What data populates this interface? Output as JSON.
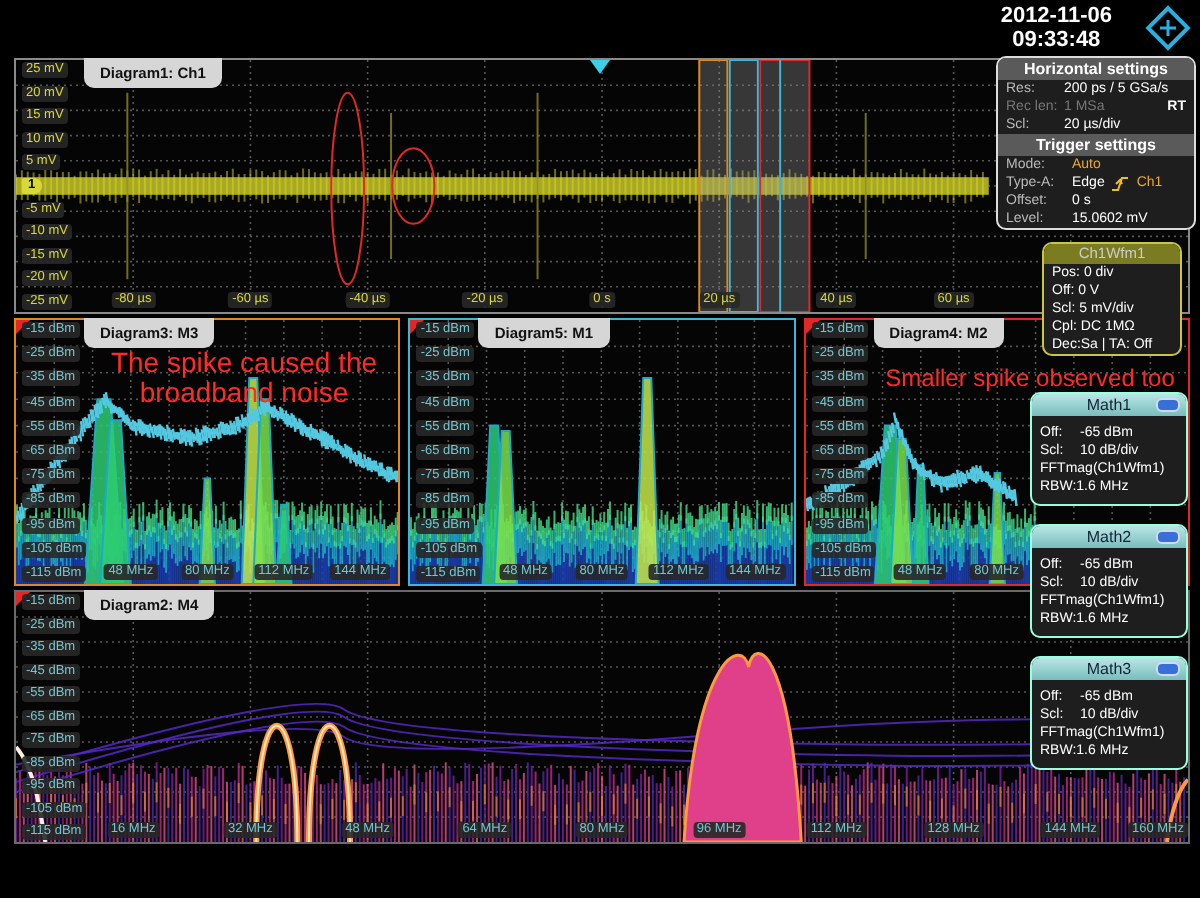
{
  "header": {
    "date": "2012-11-06",
    "time": "09:33:48"
  },
  "diagram_rows": [
    {
      "diagrams": [
        {
          "title": "Diagram1: Ch1",
          "kind": "waveform",
          "color": "#8a8a8a",
          "channel_marker": "1",
          "y_labels": [
            "25 mV",
            "20 mV",
            "15 mV",
            "10 mV",
            "5 mV",
            "-5 mV",
            "-10 mV",
            "-15 mV",
            "-20 mV",
            "-25 mV"
          ],
          "x_labels": [
            "-80 µs",
            "-60 µs",
            "-40 µs",
            "-20 µs",
            "0 s",
            "20 µs",
            "40 µs",
            "60 µs"
          ]
        }
      ]
    },
    {
      "diagrams": [
        {
          "title": "Diagram3: M3",
          "kind": "spectrum",
          "color": "#e0871e",
          "annotation": "The spike caused the broadband noise",
          "y_labels": [
            "-15 dBm",
            "-25 dBm",
            "-35 dBm",
            "-45 dBm",
            "-55 dBm",
            "-65 dBm",
            "-75 dBm",
            "-85 dBm",
            "-95 dBm",
            "-105 dBm",
            "-115 dBm"
          ],
          "x_labels": [
            "48 MHz",
            "80 MHz",
            "112 MHz",
            "144 MHz"
          ]
        },
        {
          "title": "Diagram5: M1",
          "kind": "spectrum",
          "color": "#3fb5d8",
          "y_labels": [
            "-15 dBm",
            "-25 dBm",
            "-35 dBm",
            "-45 dBm",
            "-55 dBm",
            "-65 dBm",
            "-75 dBm",
            "-85 dBm",
            "-95 dBm",
            "-105 dBm",
            "-115 dBm"
          ],
          "x_labels": [
            "48 MHz",
            "80 MHz",
            "112 MHz",
            "144 MHz"
          ]
        },
        {
          "title": "Diagram4: M2",
          "kind": "spectrum",
          "color": "#e02828",
          "annotation": "Smaller spike observed too",
          "y_labels": [
            "-15 dBm",
            "-25 dBm",
            "-35 dBm",
            "-45 dBm",
            "-55 dBm",
            "-65 dBm",
            "-75 dBm",
            "-85 dBm",
            "-95 dBm",
            "-105 dBm",
            "-115 dBm"
          ],
          "x_labels": [
            "48 MHz",
            "80 MHz"
          ]
        }
      ]
    },
    {
      "diagrams": [
        {
          "title": "Diagram2: M4",
          "kind": "persistence",
          "color": "#6a6a6a",
          "y_labels": [
            "-15 dBm",
            "-25 dBm",
            "-35 dBm",
            "-45 dBm",
            "-55 dBm",
            "-65 dBm",
            "-75 dBm",
            "-85 dBm",
            "-95 dBm",
            "-105 dBm",
            "-115 dBm"
          ],
          "x_labels": [
            "16 MHz",
            "32 MHz",
            "48 MHz",
            "64 MHz",
            "80 MHz",
            "96 MHz",
            "112 MHz",
            "128 MHz",
            "144 MHz",
            "160 MHz"
          ]
        }
      ]
    }
  ],
  "horizontal_settings": {
    "title": "Horizontal settings",
    "acquisition_mode": "RT",
    "rows": [
      {
        "label": "Res:",
        "value": "200 ps / 5 GSa/s",
        "disabled": false
      },
      {
        "label": "Rec len:",
        "value": "1 MSa",
        "disabled": true
      },
      {
        "label": "Scl:",
        "value": "20 µs/div",
        "disabled": false
      }
    ]
  },
  "trigger_settings": {
    "title": "Trigger settings",
    "rows": [
      {
        "label": "Mode:",
        "value": "Auto",
        "kind": "highlight"
      },
      {
        "label": "Type-A:",
        "value": "Edge",
        "source": "Ch1",
        "kind": "edge"
      },
      {
        "label": "Offset:",
        "value": "0 s",
        "kind": "plain"
      },
      {
        "label": "Level:",
        "value": "15.0602 mV",
        "kind": "plain"
      }
    ]
  },
  "channel_panel": {
    "title": "Ch1Wfm1",
    "rows": [
      "Pos: 0 div",
      "Off: 0 V",
      "Scl: 5 mV/div",
      "Cpl: DC 1MΩ",
      "Dec:Sa | TA: Off"
    ]
  },
  "math_panels": [
    {
      "title": "Math1",
      "rows": [
        {
          "label": "Off:",
          "value": "-65 dBm"
        },
        {
          "label": "Scl:",
          "value": "10 dB/div"
        },
        {
          "text": "FFTmag(Ch1Wfm1)"
        },
        {
          "text": "RBW:1.6 MHz"
        }
      ]
    },
    {
      "title": "Math2",
      "rows": [
        {
          "label": "Off:",
          "value": "-65 dBm"
        },
        {
          "label": "Scl:",
          "value": "10 dB/div"
        },
        {
          "text": "FFTmag(Ch1Wfm1)"
        },
        {
          "text": "RBW:1.6 MHz"
        }
      ]
    },
    {
      "title": "Math3",
      "rows": [
        {
          "label": "Off:",
          "value": "-65 dBm"
        },
        {
          "label": "Scl:",
          "value": "10 dB/div"
        },
        {
          "text": "FFTmag(Ch1Wfm1)"
        },
        {
          "text": "RBW:1.6 MHz"
        }
      ]
    }
  ]
}
